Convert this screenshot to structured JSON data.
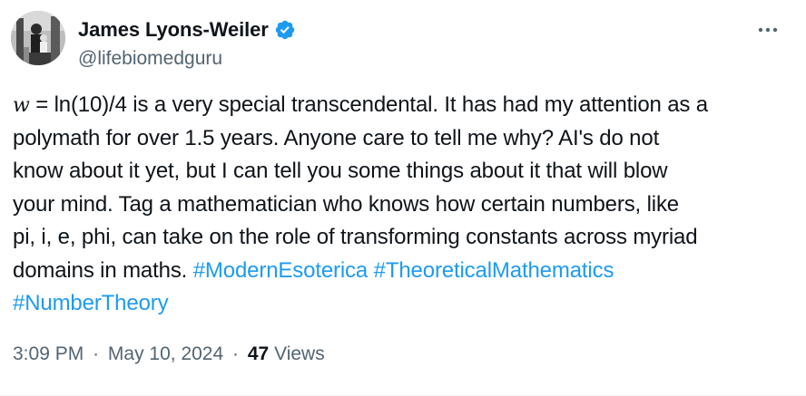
{
  "author": {
    "display_name": "James Lyons-Weiler",
    "handle": "@lifebiomedguru",
    "verified": true
  },
  "tweet": {
    "variable": "w",
    "lines": [
      {
        "rest": " = ln(10)/4 is a very special transcendental. It has had my attention as a"
      },
      {
        "text": "polymath for over 1.5 years. Anyone care to tell me why? AI's do not"
      },
      {
        "text": "know about it yet, but I can tell you some things about it that will blow"
      },
      {
        "text": "your mind. Tag a mathematician who knows how certain numbers, like"
      },
      {
        "text": "pi, i, e, phi, can take on the role of transforming constants across myriad"
      },
      {
        "text": "domains in maths. "
      }
    ],
    "hashtags": [
      "#ModernEsoterica",
      "#TheoreticalMathematics",
      "#NumberTheory"
    ]
  },
  "meta": {
    "time": "3:09 PM",
    "separator": "·",
    "date": "May 10, 2024",
    "views_count": "47",
    "views_label": "Views"
  },
  "colors": {
    "text": "#0f1419",
    "secondary": "#536471",
    "link": "#1d9bf0",
    "verified": "#1d9bf0"
  },
  "icons": {
    "verified": "verified-badge-icon",
    "more": "more-options-icon"
  }
}
